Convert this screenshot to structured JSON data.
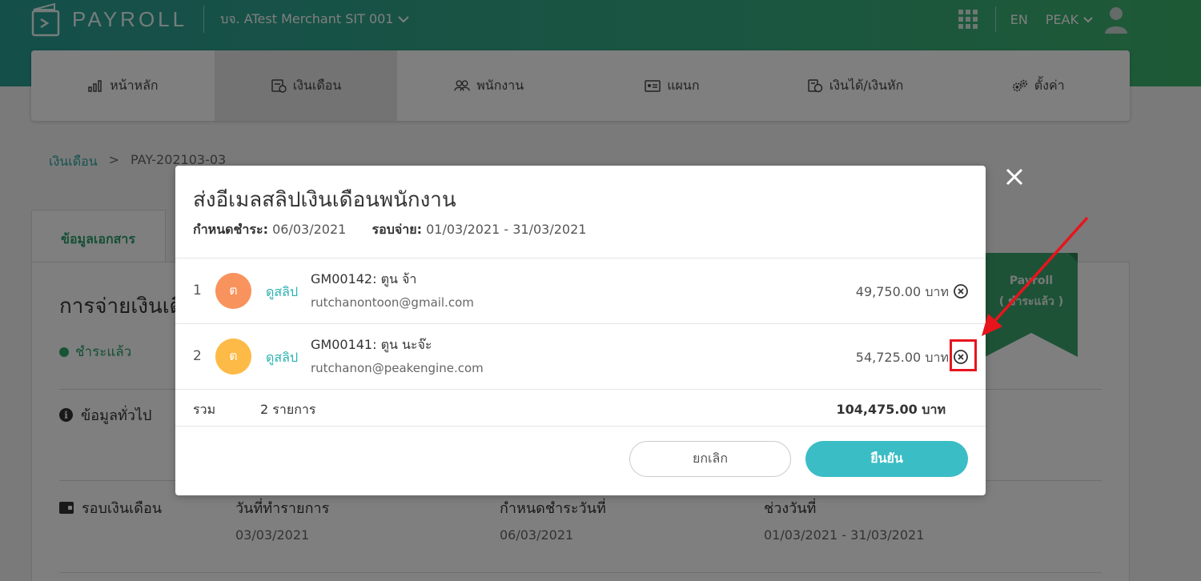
{
  "app": {
    "logo_text": "PAYROLL",
    "merchant": "บจ. ATest Merchant SIT 001",
    "lang": "EN",
    "user": "PEAK"
  },
  "nav": [
    {
      "label": "หน้าหลัก",
      "icon": "bar-chart-icon"
    },
    {
      "label": "เงินเดือน",
      "icon": "payroll-icon",
      "active": true
    },
    {
      "label": "พนักงาน",
      "icon": "people-icon"
    },
    {
      "label": "แผนก",
      "icon": "id-card-icon"
    },
    {
      "label": "เงินได้/เงินหัก",
      "icon": "income-deduct-icon"
    },
    {
      "label": "ตั้งค่า",
      "icon": "gears-icon"
    }
  ],
  "breadcrumb": {
    "root": "เงินเดือน",
    "sep": ">",
    "current": "PAY-202103-03"
  },
  "doc_tab": "ข้อมูลเอกสาร",
  "page": {
    "title": "การจ่ายเงินเดือน",
    "status": "ชำระแล้ว",
    "section_general": "ข้อมูลทั่วไป",
    "section_cycle": "รอบเงินเดือน",
    "cols": [
      {
        "label": "วันที่ทำรายการ",
        "value": "03/03/2021"
      },
      {
        "label": "กำหนดชำระวันที่",
        "value": "06/03/2021"
      },
      {
        "label": "ช่วงวันที่",
        "value": "01/03/2021 - 31/03/2021"
      }
    ],
    "ribbon_line1": "Payroll",
    "ribbon_line2": "( ชำระแล้ว )"
  },
  "modal": {
    "title": "ส่งอีเมลสลิปเงินเดือนพนักงาน",
    "due_label": "กำหนดชำระ:",
    "due_value": "06/03/2021",
    "cycle_label": "รอบจ่าย:",
    "cycle_value": "01/03/2021 - 31/03/2021",
    "view_label": "ดูสลิป",
    "rows": [
      {
        "num": "1",
        "initial": "ต",
        "name": "GM00142: ตูน จ้า",
        "email": "rutchanontoon@gmail.com",
        "amount": "49,750.00 บาท",
        "color": "#f9935e"
      },
      {
        "num": "2",
        "initial": "ต",
        "name": "GM00141: ตูน นะจ๊ะ",
        "email": "rutchanon@peakengine.com",
        "amount": "54,725.00 บาท",
        "color": "#fdba47"
      }
    ],
    "total_label": "รวม",
    "total_count": "2 รายการ",
    "total_amount": "104,475.00 บาท",
    "cancel": "ยกเลิก",
    "confirm": "ยืนยัน"
  },
  "colors": {
    "teal": "#2a9e95",
    "green": "#3db36c",
    "confirm": "#3bbdc6",
    "annotation": "#e8141c"
  }
}
